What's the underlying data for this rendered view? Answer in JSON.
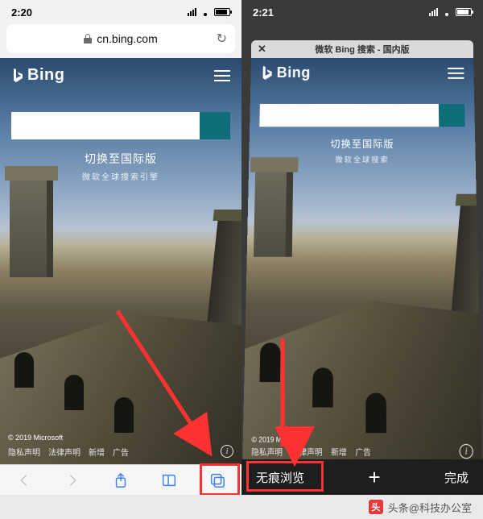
{
  "left": {
    "time": "2:20",
    "address": "cn.bing.com",
    "bing": {
      "logo": "Bing",
      "switch_text": "切换至国际版",
      "switch_sub": "微软全球搜索引擎",
      "copyright": "© 2019 Microsoft",
      "links": {
        "privacy": "隐私声明",
        "legal": "法律声明",
        "add": "新增",
        "ads": "广告"
      }
    }
  },
  "right": {
    "time": "2:21",
    "tab_title": "微软 Bing 搜索 - 国内版",
    "close_x": "✕",
    "bing": {
      "logo": "Bing",
      "switch_text": "切换至国际版",
      "switch_sub": "微软全球搜索",
      "copyright": "© 2019 Microsoft",
      "links": {
        "privacy": "隐私声明",
        "legal": "法律声明",
        "add": "新增",
        "ads": "广告"
      }
    },
    "toolbar": {
      "private": "无痕浏览",
      "done": "完成"
    }
  },
  "watermark": {
    "badge": "头",
    "text": "头条@科技办公室"
  }
}
